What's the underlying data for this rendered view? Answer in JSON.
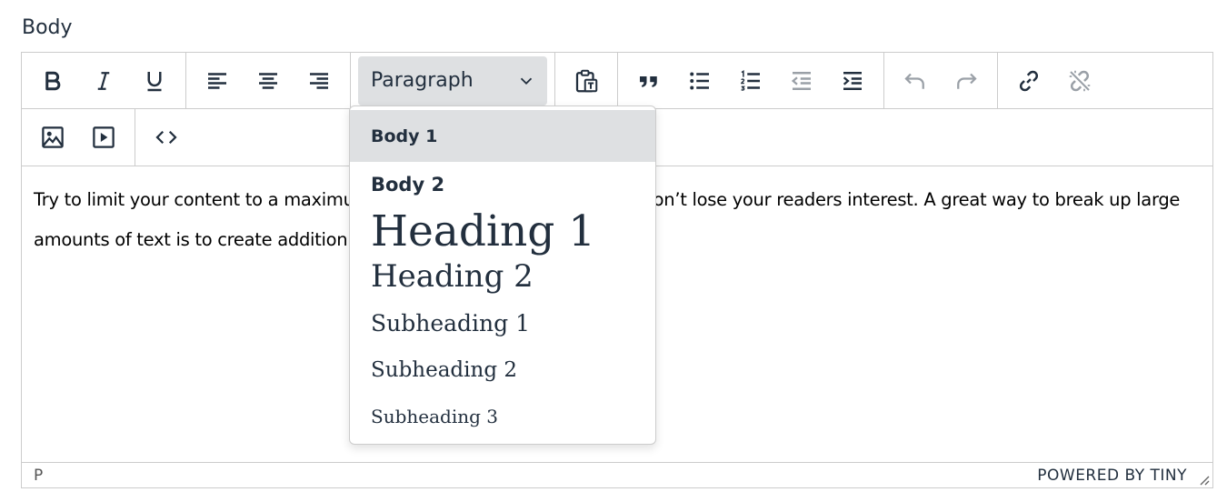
{
  "field": {
    "label": "Body"
  },
  "toolbar": {
    "block_format": {
      "selected": "Paragraph"
    }
  },
  "format_menu": {
    "items": [
      "Body 1",
      "Body 2",
      "Heading 1",
      "Heading 2",
      "Subheading 1",
      "Subheading 2",
      "Subheading 3"
    ],
    "highlighted": "Body 1"
  },
  "content": {
    "line1_left": "Try to limit your content to a maximu",
    "line1_right": "on’t lose your readers interest. A great way to break up large",
    "line2_left": "amounts of text is to create addition"
  },
  "statusbar": {
    "path": "P",
    "branding": "POWERED BY TINY"
  },
  "colors": {
    "text": "#222f3e",
    "border": "#cccccc",
    "hover": "#dee0e2"
  }
}
